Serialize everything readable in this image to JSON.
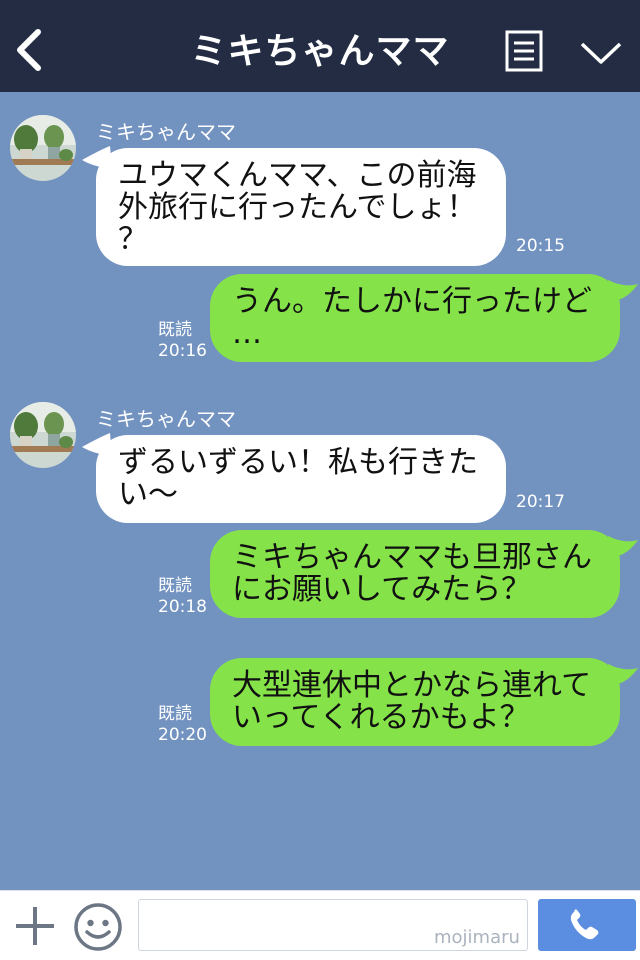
{
  "header": {
    "title": "ミキちゃんママ",
    "back_icon": "chevron-left-icon",
    "menu_icon": "menu-icon",
    "collapse_icon": "chevron-down-icon"
  },
  "messages": [
    {
      "direction": "incoming",
      "sender": "ミキちゃんママ",
      "lines": [
        "ユウマくんママ、この前海",
        "外旅行に行ったんでしょ！",
        "？"
      ],
      "time": "20:15"
    },
    {
      "direction": "outgoing",
      "lines": [
        "うん。たしかに行ったけど",
        "…"
      ],
      "read": "既読",
      "time": "20:16"
    },
    {
      "direction": "incoming",
      "sender": "ミキちゃんママ",
      "lines": [
        "ずるいずるい！私も行きた",
        "い〜"
      ],
      "time": "20:17"
    },
    {
      "direction": "outgoing",
      "lines": [
        "ミキちゃんママも旦那さん",
        "にお願いしてみたら？"
      ],
      "read": "既読",
      "time": "20:18"
    },
    {
      "direction": "outgoing",
      "lines": [
        "大型連休中とかなら連れて",
        "いってくれるかもよ？"
      ],
      "read": "既読",
      "time": "20:20"
    }
  ],
  "footer": {
    "input_value": "",
    "watermark": "mojimaru",
    "plus_icon": "plus-icon",
    "emoji_icon": "smiley-icon",
    "call_icon": "phone-icon"
  },
  "colors": {
    "header_bg": "#232c43",
    "chat_bg": "#7292c0",
    "incoming_bubble": "#ffffff",
    "outgoing_bubble": "#85e249",
    "call_button": "#5b8ee0"
  }
}
